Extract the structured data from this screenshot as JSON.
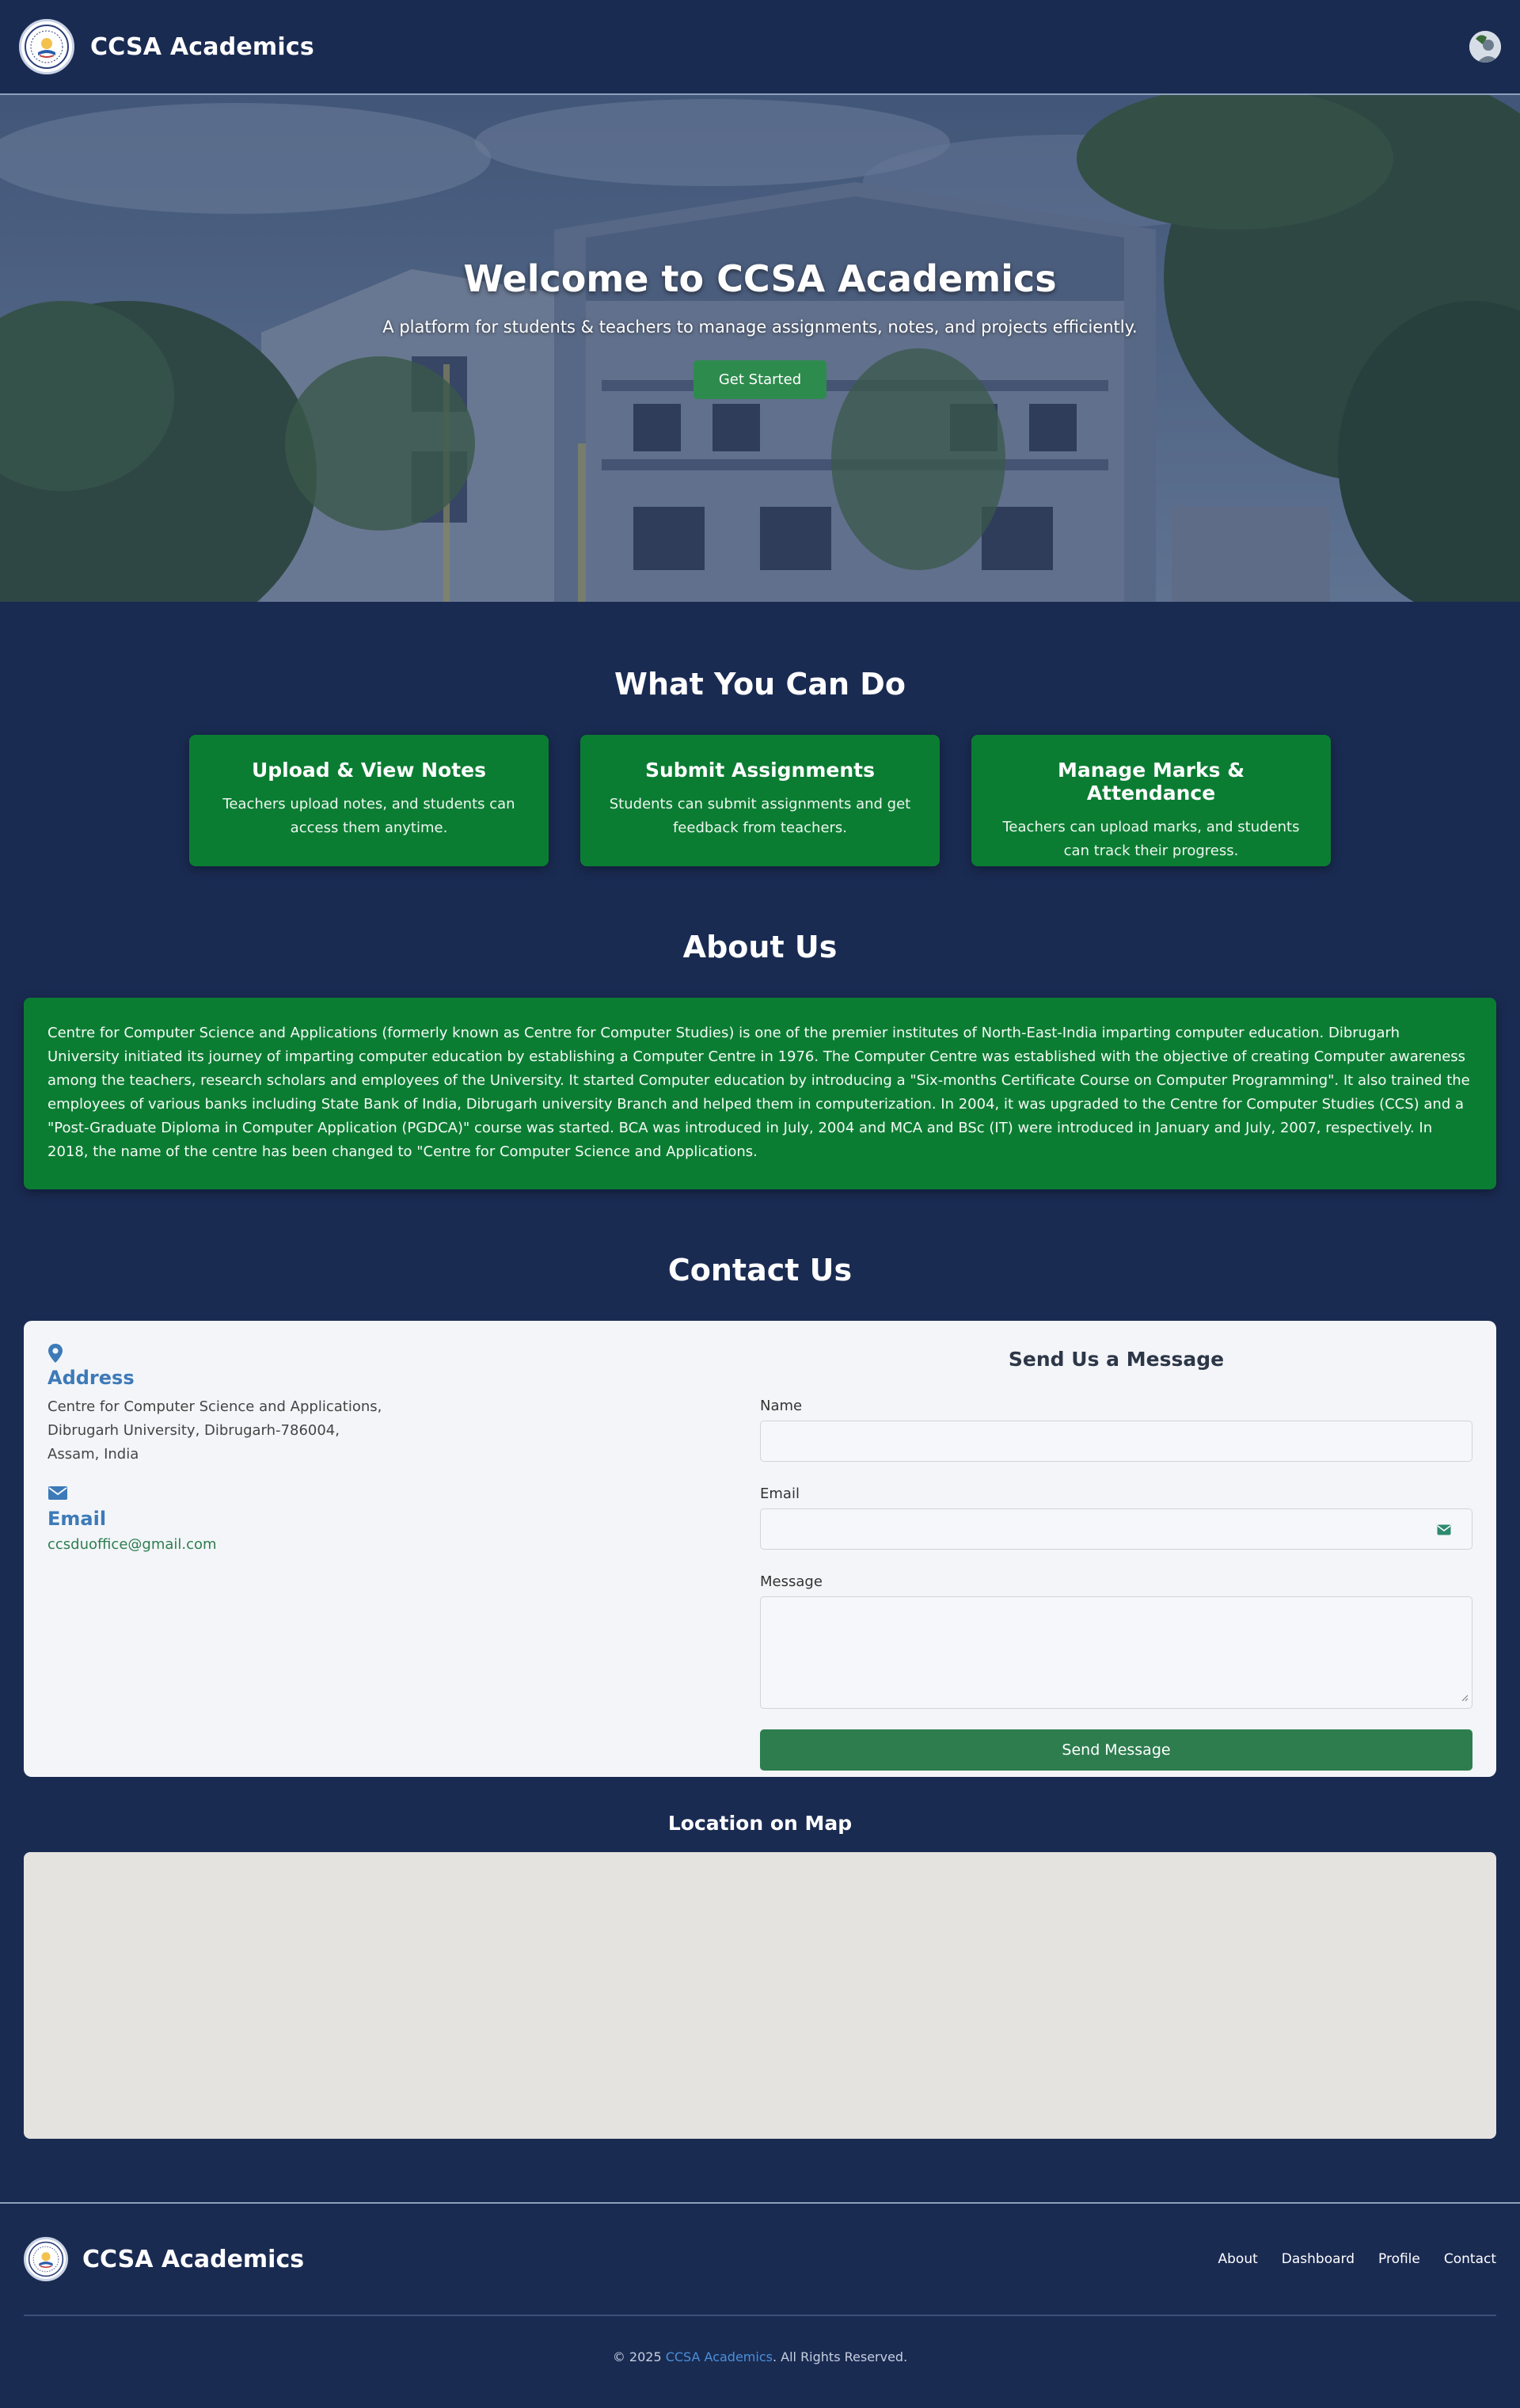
{
  "nav": {
    "brand": "CCSA Academics",
    "user_alt": "User"
  },
  "hero": {
    "title": "Welcome to CCSA Academics",
    "subtitle": "A platform for students & teachers to manage assignments, notes, and projects efficiently.",
    "button": "Get Started"
  },
  "features": {
    "title": "What You Can Do",
    "items": [
      {
        "title": "Upload & View Notes",
        "desc": "Teachers upload notes, and students can access them anytime."
      },
      {
        "title": "Submit Assignments",
        "desc": "Students can submit assignments and get feedback from teachers."
      },
      {
        "title": "Manage Marks & Attendance",
        "desc": "Teachers can upload marks, and students can track their progress."
      }
    ]
  },
  "about": {
    "title": "About Us",
    "text": "Centre for Computer Science and Applications (formerly known as Centre for Computer Studies) is one of the premier institutes of North-East-India imparting computer education. Dibrugarh University initiated its journey of imparting computer education by establishing a Computer Centre in 1976. The Computer Centre was established with the objective of creating Computer awareness among the teachers, research scholars and employees of the University. It started Computer education by introducing a \"Six-months Certificate Course on Computer Programming\". It also trained the employees of various banks including State Bank of India, Dibrugarh university Branch and helped them in computerization. In 2004, it was upgraded to the Centre for Computer Studies (CCS) and a \"Post-Graduate Diploma in Computer Application (PGDCA)\" course was started. BCA was introduced in July, 2004 and MCA and BSc (IT) were introduced in January and July, 2007, respectively. In 2018, the name of the centre has been changed to \"Centre for Computer Science and Applications."
  },
  "contact": {
    "title": "Contact Us",
    "address_heading": "Address",
    "address_lines": [
      "Centre for Computer Science and Applications,",
      "Dibrugarh University, Dibrugarh-786004,",
      "Assam, India"
    ],
    "email_heading": "Email",
    "email": "ccsduoffice@gmail.com",
    "form": {
      "title": "Send Us a Message",
      "name_label": "Name",
      "email_label": "Email",
      "message_label": "Message",
      "submit": "Send Message"
    }
  },
  "map": {
    "title": "Location on Map"
  },
  "footer": {
    "brand": "CCSA Academics",
    "links": [
      "About",
      "Dashboard",
      "Profile",
      "Contact"
    ],
    "copyright_prefix": "© 2025 ",
    "copyright_brand": "CCSA Academics",
    "copyright_suffix": ". All Rights Reserved."
  },
  "colors": {
    "background": "#1a2b52",
    "card_green": "#0b7d33",
    "button_green": "#2e8b4e",
    "accent_blue": "#3d7ab8"
  }
}
